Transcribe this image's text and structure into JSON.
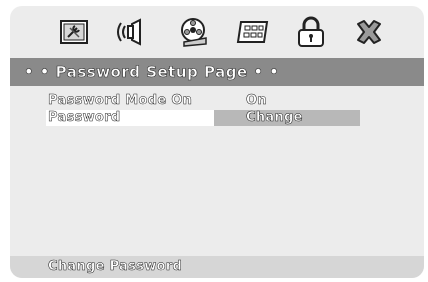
{
  "tabs": [
    {
      "icon": "general-setup-icon"
    },
    {
      "icon": "audio-setup-icon"
    },
    {
      "icon": "video-reel-icon"
    },
    {
      "icon": "display-setup-icon"
    },
    {
      "icon": "lock-icon",
      "active": true
    },
    {
      "icon": "exit-icon"
    }
  ],
  "header": {
    "title": "• • Password Setup Page • •"
  },
  "rows": [
    {
      "label": "Password Mode On",
      "value": "On"
    },
    {
      "label": "Password",
      "value": "Change",
      "selected": true
    }
  ],
  "footer": {
    "text": "Change Password"
  },
  "colors": {
    "panel": "#ececec",
    "header": "#8a8a8a",
    "selected_value": "#b8b8b8",
    "footer": "#d6d6d6"
  }
}
